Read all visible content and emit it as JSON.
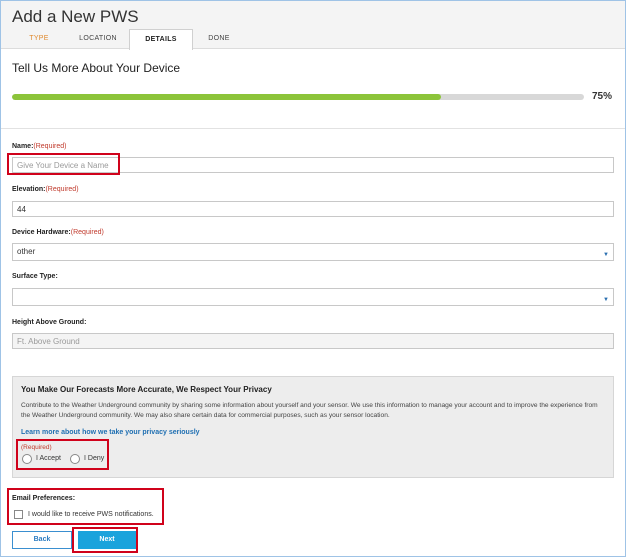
{
  "page": {
    "title": "Add a New PWS"
  },
  "tabs": [
    {
      "label": "TYPE",
      "state": "completed"
    },
    {
      "label": "LOCATION",
      "state": "default"
    },
    {
      "label": "DETAILS",
      "state": "active"
    },
    {
      "label": "DONE",
      "state": "default"
    }
  ],
  "section": {
    "title": "Tell Us More About Your Device"
  },
  "progress": {
    "value": 75,
    "label": "75%"
  },
  "fields": {
    "name": {
      "label": "Name:",
      "required": "(Required)",
      "placeholder": "Give Your Device a Name",
      "value": ""
    },
    "elevation": {
      "label": "Elevation:",
      "required": "(Required)",
      "value": "44"
    },
    "hardware": {
      "label": "Device Hardware:",
      "required": "(Required)",
      "value": "other"
    },
    "surface": {
      "label": "Surface Type:",
      "value": ""
    },
    "height": {
      "label": "Height Above Ground:",
      "placeholder": "Ft. Above Ground",
      "value": ""
    }
  },
  "privacy": {
    "title": "You Make Our Forecasts More Accurate, We Respect Your Privacy",
    "text": "Contribute to the Weather Underground community by sharing some information about yourself and your sensor. We use this information to manage your account and to improve the experience from the Weather Underground community. We may also share certain data for commercial purposes, such as your sensor location.",
    "link": "Learn more about how we take your privacy seriously",
    "required": "(Required)",
    "accept": "I Accept",
    "deny": "I Deny"
  },
  "email": {
    "label": "Email Preferences:",
    "checkbox_label": "I would like to receive PWS notifications."
  },
  "buttons": {
    "back": "Back",
    "next": "Next"
  },
  "colors": {
    "accent": "#1aa3dc",
    "progress": "#8cc43a",
    "required": "#c0392b",
    "highlight": "#d0021b",
    "completed_tab": "#e08a2e"
  }
}
